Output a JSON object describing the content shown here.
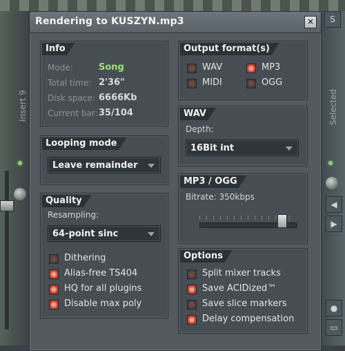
{
  "dialog": {
    "title": "Rendering to KUSZYN.mp3",
    "close_label": "×"
  },
  "background": {
    "left_vertical_text": "Insert 9",
    "right_vertical_text": "Selected"
  },
  "info": {
    "header": "Info",
    "rows": [
      {
        "label": "Mode:",
        "value": "Song",
        "highlight": true
      },
      {
        "label": "Total time:",
        "value": "2'36\""
      },
      {
        "label": "Disk space:",
        "value": "6666Kb"
      },
      {
        "label": "Current bar:",
        "value": "35/104"
      }
    ]
  },
  "looping": {
    "header": "Looping mode",
    "selected": "Leave remainder"
  },
  "quality": {
    "header": "Quality",
    "resampling_label": "Resampling:",
    "resampling_selected": "64-point sinc",
    "options": [
      {
        "label": "Dithering",
        "checked": false
      },
      {
        "label": "Alias-free TS404",
        "checked": true
      },
      {
        "label": "HQ for all plugins",
        "checked": true
      },
      {
        "label": "Disable max poly",
        "checked": true
      }
    ]
  },
  "output": {
    "header": "Output format(s)",
    "formats": [
      {
        "label": "WAV",
        "checked": false
      },
      {
        "label": "MP3",
        "checked": true
      },
      {
        "label": "MIDI",
        "checked": false
      },
      {
        "label": "OGG",
        "checked": false
      }
    ]
  },
  "wav": {
    "header": "WAV",
    "depth_label": "Depth:",
    "depth_selected": "16Bit int"
  },
  "mp3ogg": {
    "header": "MP3 / OGG",
    "bitrate_label": "Bitrate: 350kbps",
    "bitrate_kbps": 350,
    "bitrate_level": 0.9
  },
  "options": {
    "header": "Options",
    "items": [
      {
        "label": "Split mixer tracks",
        "checked": false
      },
      {
        "label": "Save ACIDized™",
        "checked": true
      },
      {
        "label": "Save slice markers",
        "checked": false
      },
      {
        "label": "Delay compensation",
        "checked": true
      }
    ]
  },
  "colors": {
    "accent_green": "#9ee36c",
    "checkbox_on": "#d4442f",
    "dialog_bg": "#525a60"
  }
}
